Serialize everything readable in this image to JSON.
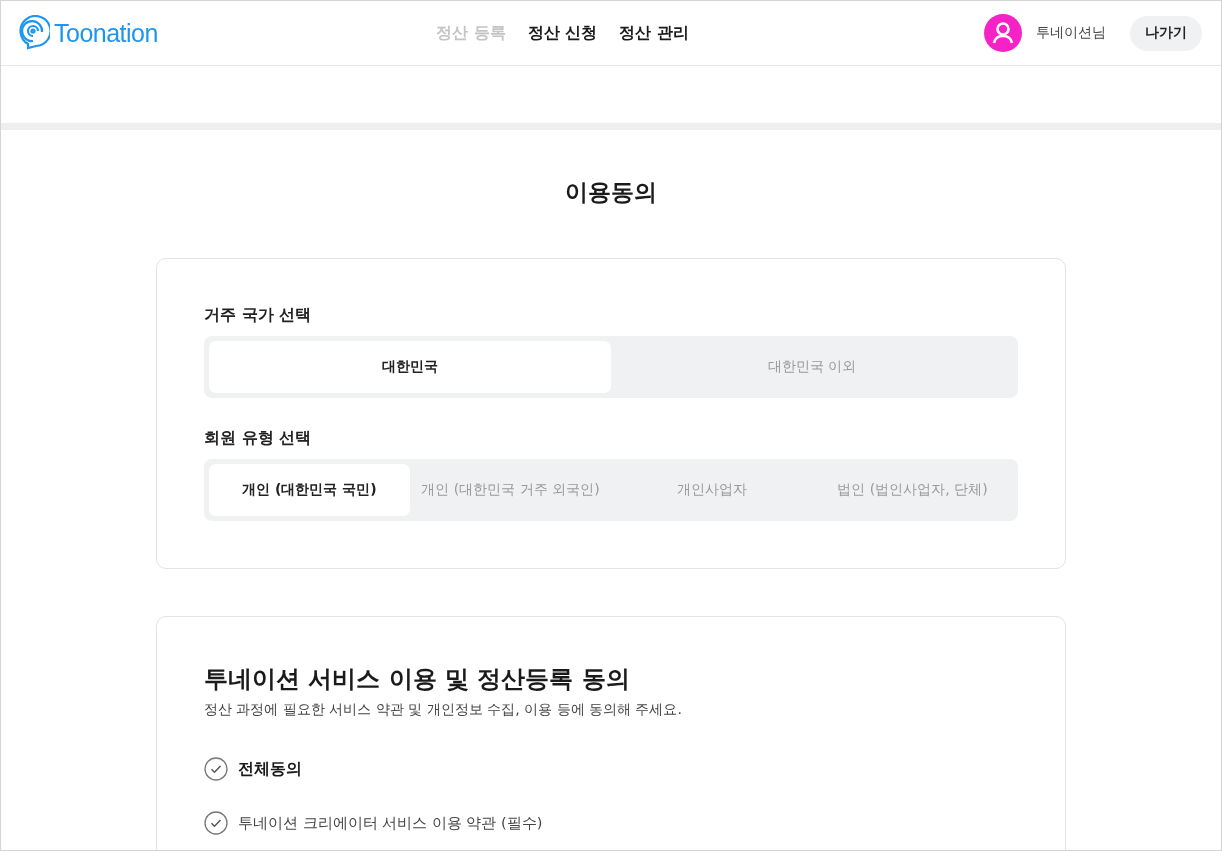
{
  "header": {
    "logo": "Toonation",
    "nav": [
      {
        "label": "정산 등록",
        "dimmed": true
      },
      {
        "label": "정산 신청",
        "dimmed": false
      },
      {
        "label": "정산 관리",
        "dimmed": false
      }
    ],
    "user": "투네이션님",
    "exit_button": "나가기"
  },
  "page_title": "이용동의",
  "selection_card": {
    "groups": [
      {
        "label": "거주 국가 선택",
        "options": [
          {
            "label": "대한민국",
            "selected": true
          },
          {
            "label": "대한민국 이외",
            "selected": false
          }
        ]
      },
      {
        "label": "회원 유형 선택",
        "options": [
          {
            "label": "개인 (대한민국 국민)",
            "selected": true
          },
          {
            "label": "개인 (대한민국 거주 외국인)",
            "selected": false
          },
          {
            "label": "개인사업자",
            "selected": false
          },
          {
            "label": "법인 (법인사업자, 단체)",
            "selected": false
          }
        ]
      }
    ]
  },
  "agreement_card": {
    "title": "투네이션 서비스 이용 및 정산등록 동의",
    "subtitle": "정산 과정에 필요한 서비스 약관 및 개인정보 수집, 이용 등에 동의해 주세요.",
    "items": [
      {
        "label": "전체동의",
        "kind": "all",
        "checked": false
      },
      {
        "label": "투네이션 크리에이터 서비스 이용 약관 (필수)",
        "kind": "item",
        "checked": false
      }
    ]
  }
}
